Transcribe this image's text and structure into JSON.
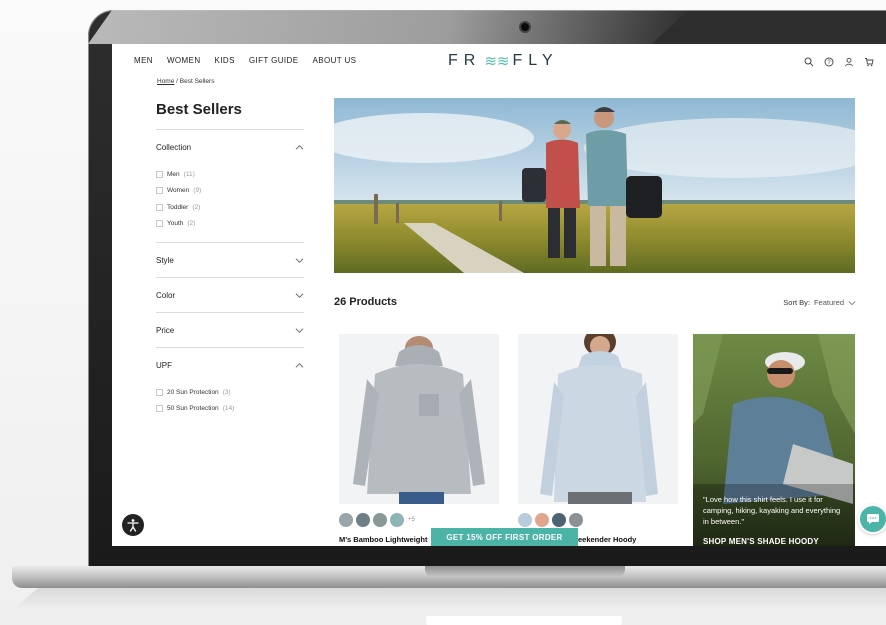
{
  "nav": {
    "items": [
      "MEN",
      "WOMEN",
      "KIDS",
      "GIFT GUIDE",
      "ABOUT US"
    ],
    "logo_left": "FR",
    "logo_right": "FLY",
    "icons": [
      "search-icon",
      "help-icon",
      "account-icon",
      "cart-icon"
    ]
  },
  "breadcrumb": {
    "home": "Home",
    "separator": "/",
    "current": "Best Sellers"
  },
  "page": {
    "title": "Best Sellers"
  },
  "filters": {
    "collection": {
      "label": "Collection",
      "options": [
        {
          "label": "Men",
          "count": "(11)"
        },
        {
          "label": "Women",
          "count": "(9)"
        },
        {
          "label": "Toddler",
          "count": "(2)"
        },
        {
          "label": "Youth",
          "count": "(2)"
        }
      ]
    },
    "style": {
      "label": "Style"
    },
    "color": {
      "label": "Color"
    },
    "price": {
      "label": "Price"
    },
    "upf": {
      "label": "UPF",
      "options": [
        {
          "label": "20 Sun Protection",
          "count": "(3)"
        },
        {
          "label": "50 Sun Protection",
          "count": "(14)"
        }
      ]
    }
  },
  "results": {
    "count_label": "26 Products",
    "sort_label": "Sort By:",
    "sort_value": "Featured"
  },
  "products": [
    {
      "name": "M's Bamboo Lightweight",
      "swatches": [
        "#9aa4ab",
        "#6d7f88",
        "#899a96",
        "#8fb4b8"
      ],
      "more": "+5"
    },
    {
      "name": "eekender Hoody",
      "swatches": [
        "#b8ccdc",
        "#e0a68c",
        "#4d6275",
        "#8b9296"
      ],
      "more": ""
    }
  ],
  "promo": {
    "quote": "\"Love how this shirt feels. I use it for camping, hiking, kayaking and everything in between.\"",
    "cta": "SHOP MEN'S SHADE HOODY"
  },
  "offer": {
    "label": "GET 15% OFF FIRST ORDER"
  },
  "colors": {
    "accent": "#4cb3a7",
    "logo": "#2a3a43"
  }
}
